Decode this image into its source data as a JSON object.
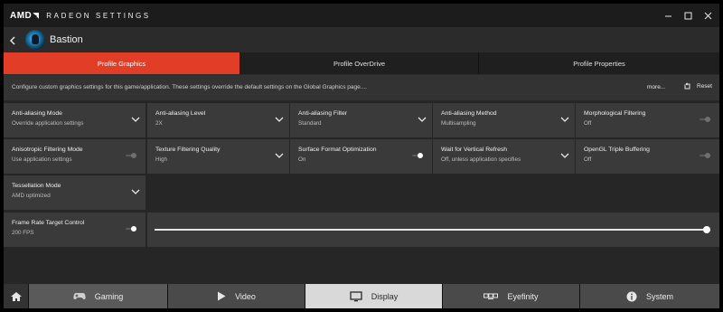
{
  "app": {
    "brand": "AMD",
    "title": "RADEON SETTINGS"
  },
  "game": {
    "name": "Bastion"
  },
  "tabs": [
    {
      "label": "Profile Graphics",
      "active": true
    },
    {
      "label": "Profile OverDrive",
      "active": false
    },
    {
      "label": "Profile Properties",
      "active": false
    }
  ],
  "description": {
    "text": "Configure custom graphics settings for this game/application. These settings override the default settings on the Global Graphics page....",
    "more_label": "more...",
    "reset_label": "Reset"
  },
  "settings": [
    {
      "label": "Anti-aliasing Mode",
      "value": "Override application settings",
      "control": "dropdown"
    },
    {
      "label": "Anti-aliasing Level",
      "value": "2X",
      "control": "dropdown"
    },
    {
      "label": "Anti-aliasing Filter",
      "value": "Standard",
      "control": "dropdown"
    },
    {
      "label": "Anti-aliasing Method",
      "value": "Multisampling",
      "control": "dropdown"
    },
    {
      "label": "Morphological Filtering",
      "value": "Off",
      "control": "toggle",
      "on": false
    },
    {
      "label": "Anisotropic Filtering Mode",
      "value": "Use application settings",
      "control": "toggle",
      "on": false
    },
    {
      "label": "Texture Filtering Quality",
      "value": "High",
      "control": "dropdown"
    },
    {
      "label": "Surface Format Optimization",
      "value": "On",
      "control": "toggle",
      "on": true
    },
    {
      "label": "Wait for Vertical Refresh",
      "value": "Off, unless application specifies",
      "control": "dropdown"
    },
    {
      "label": "OpenGL Triple Buffering",
      "value": "Off",
      "control": "toggle",
      "on": false
    },
    {
      "label": "Tessellation Mode",
      "value": "AMD optimized",
      "control": "dropdown"
    }
  ],
  "frame_rate": {
    "label": "Frame Rate Target Control",
    "value": "200 FPS",
    "enabled": true,
    "slider_fraction": 1.0
  },
  "bottom_nav": [
    {
      "label": "Gaming",
      "icon": "gamepad-icon",
      "state": "selected"
    },
    {
      "label": "Video",
      "icon": "play-icon",
      "state": "normal"
    },
    {
      "label": "Display",
      "icon": "monitor-icon",
      "state": "active"
    },
    {
      "label": "Eyefinity",
      "icon": "eyefinity-icon",
      "state": "normal"
    },
    {
      "label": "System",
      "icon": "info-icon",
      "state": "normal"
    }
  ],
  "colors": {
    "accent": "#e23d27",
    "panel": "#3a3a3a",
    "background": "#2b2b2b"
  }
}
